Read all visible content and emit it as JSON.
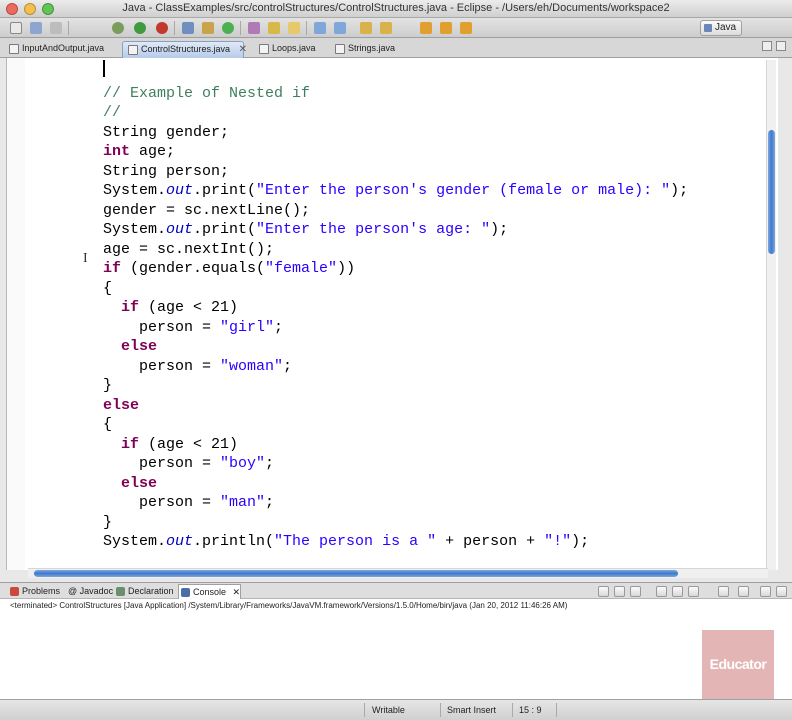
{
  "window": {
    "title": "Java - ClassExamples/src/controlStructures/ControlStructures.java - Eclipse - /Users/eh/Documents/workspace2"
  },
  "toolbar": {
    "perspective_label": "Java",
    "icons": [
      "new-icon",
      "save-icon",
      "debug-icon",
      "run-icon",
      "external-tools-icon",
      "new-java-project-icon",
      "new-package-icon",
      "new-class-icon",
      "open-type-icon",
      "search-icon",
      "annotation-icon",
      "next-annotation-icon",
      "previous-annotation-icon",
      "back-icon",
      "forward-icon"
    ]
  },
  "editor_tabs": [
    {
      "label": "InputAndOutput.java",
      "active": false
    },
    {
      "label": "ControlStructures.java",
      "active": true,
      "close": "✕"
    },
    {
      "label": "Loops.java",
      "active": false
    },
    {
      "label": "Strings.java",
      "active": false
    }
  ],
  "code_lines": [
    [],
    [
      {
        "t": "// Example of Nested if",
        "c": "cm"
      }
    ],
    [
      {
        "t": "//",
        "c": "cm"
      }
    ],
    [
      {
        "t": "String gender;",
        "c": ""
      }
    ],
    [
      {
        "t": "int",
        "c": "kw"
      },
      {
        "t": " age;",
        "c": ""
      }
    ],
    [
      {
        "t": "String person;",
        "c": ""
      }
    ],
    [
      {
        "t": "System.",
        "c": ""
      },
      {
        "t": "out",
        "c": "fld"
      },
      {
        "t": ".print(",
        "c": ""
      },
      {
        "t": "\"Enter the person's gender (female or male): \"",
        "c": "str"
      },
      {
        "t": ");",
        "c": ""
      }
    ],
    [
      {
        "t": "gender = sc.nextLine();",
        "c": ""
      }
    ],
    [
      {
        "t": "System.",
        "c": ""
      },
      {
        "t": "out",
        "c": "fld"
      },
      {
        "t": ".print(",
        "c": ""
      },
      {
        "t": "\"Enter the person's age: \"",
        "c": "str"
      },
      {
        "t": ");",
        "c": ""
      }
    ],
    [
      {
        "t": "age = sc.nextInt();",
        "c": ""
      }
    ],
    [
      {
        "t": "if",
        "c": "kw"
      },
      {
        "t": " (gender.equals(",
        "c": ""
      },
      {
        "t": "\"female\"",
        "c": "str"
      },
      {
        "t": "))",
        "c": ""
      }
    ],
    [
      {
        "t": "{",
        "c": ""
      }
    ],
    [
      {
        "t": "  ",
        "c": ""
      },
      {
        "t": "if",
        "c": "kw"
      },
      {
        "t": " (age < 21)",
        "c": ""
      }
    ],
    [
      {
        "t": "    person = ",
        "c": ""
      },
      {
        "t": "\"girl\"",
        "c": "str"
      },
      {
        "t": ";",
        "c": ""
      }
    ],
    [
      {
        "t": "  ",
        "c": ""
      },
      {
        "t": "else",
        "c": "kw"
      }
    ],
    [
      {
        "t": "    person = ",
        "c": ""
      },
      {
        "t": "\"woman\"",
        "c": "str"
      },
      {
        "t": ";",
        "c": ""
      }
    ],
    [
      {
        "t": "}",
        "c": ""
      }
    ],
    [
      {
        "t": "else",
        "c": "kw"
      }
    ],
    [
      {
        "t": "{",
        "c": ""
      }
    ],
    [
      {
        "t": "  ",
        "c": ""
      },
      {
        "t": "if",
        "c": "kw"
      },
      {
        "t": " (age < 21)",
        "c": ""
      }
    ],
    [
      {
        "t": "    person = ",
        "c": ""
      },
      {
        "t": "\"boy\"",
        "c": "str"
      },
      {
        "t": ";",
        "c": ""
      }
    ],
    [
      {
        "t": "  ",
        "c": ""
      },
      {
        "t": "else",
        "c": "kw"
      }
    ],
    [
      {
        "t": "    person = ",
        "c": ""
      },
      {
        "t": "\"man\"",
        "c": "str"
      },
      {
        "t": ";",
        "c": ""
      }
    ],
    [
      {
        "t": "}",
        "c": ""
      }
    ],
    [
      {
        "t": "System.",
        "c": ""
      },
      {
        "t": "out",
        "c": "fld"
      },
      {
        "t": ".println(",
        "c": ""
      },
      {
        "t": "\"The person is a \"",
        "c": "str"
      },
      {
        "t": " + person + ",
        "c": ""
      },
      {
        "t": "\"!\"",
        "c": "str"
      },
      {
        "t": ");",
        "c": ""
      }
    ]
  ],
  "bottom_tabs": [
    {
      "label": "Problems",
      "icon": "problems-icon",
      "color": "#c94a3a",
      "active": false
    },
    {
      "label": "@ Javadoc",
      "icon": "javadoc-icon",
      "color": "#7a8fb3",
      "active": false
    },
    {
      "label": "Declaration",
      "icon": "declaration-icon",
      "color": "#6b8e6b",
      "active": false
    },
    {
      "label": "Console",
      "icon": "console-icon",
      "color": "#4a6fa8",
      "active": true,
      "close": "✕"
    }
  ],
  "console": {
    "status": "<terminated> ControlStructures [Java Application] /System/Library/Frameworks/JavaVM.framework/Versions/1.5.0/Home/bin/java (Jan 20, 2012 11:46:26 AM)"
  },
  "statusbar": {
    "writable": "Writable",
    "insert_mode": "Smart Insert",
    "position": "15 : 9"
  },
  "watermark": {
    "text": "Educator"
  },
  "colors": {
    "keyword": "#7f0055",
    "string": "#2a00ff",
    "comment": "#3f7f5f",
    "field": "#0000c0",
    "scroll_thumb": "#3d79cf"
  }
}
